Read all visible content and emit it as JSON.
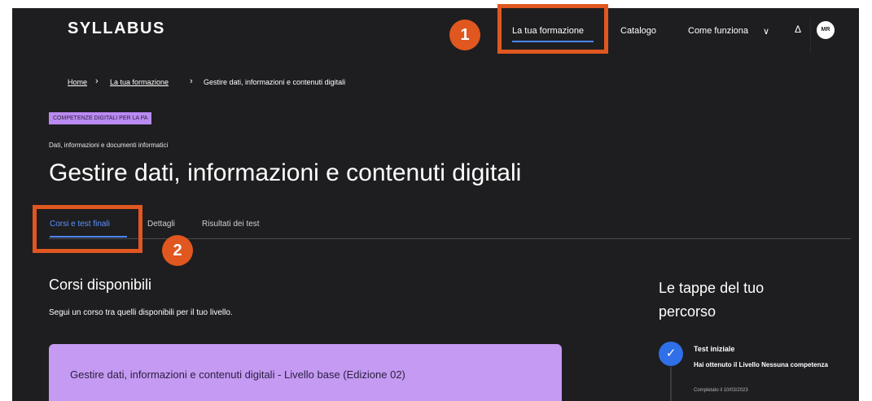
{
  "header": {
    "logo": "SYLLABUS",
    "nav": {
      "formazione": "La tua formazione",
      "catalogo": "Catalogo",
      "come_funziona": "Come funziona",
      "chevron": "∨"
    },
    "bell_glyph": "Δ",
    "avatar_initials": "MR"
  },
  "breadcrumb": {
    "home": "Home",
    "sep": "›",
    "formazione": "La tua formazione",
    "current": "Gestire dati, informazioni e contenuti digitali"
  },
  "page": {
    "tag": "COMPETENZE DIGITALI PER LA PA",
    "subtitle": "Dati, informazioni e documenti informatici",
    "title": "Gestire dati, informazioni e contenuti digitali"
  },
  "tabs": [
    {
      "label": "Corsi e test finali",
      "active": true
    },
    {
      "label": "Dettagli",
      "active": false
    },
    {
      "label": "Risultati dei test",
      "active": false
    }
  ],
  "courses": {
    "title": "Corsi disponibili",
    "description": "Segui un corso tra quelli disponibili per il tuo livello.",
    "items": [
      {
        "title": "Gestire dati, informazioni e contenuti digitali - Livello base (Edizione 02)"
      }
    ]
  },
  "journey": {
    "title": "Le tappe del tuo percorso",
    "steps": [
      {
        "title": "Test iniziale",
        "description": "Hai ottenuto il Livello Nessuna competenza",
        "date": "Completato il 10/03/2023",
        "icon": "check-icon",
        "glyph": "✓"
      }
    ]
  },
  "annotations": {
    "badge1": "1",
    "badge2": "2",
    "color": "#e0571f"
  },
  "colors": {
    "background": "#1e1e20",
    "accent": "#4d86ff",
    "tag": "#b98af0",
    "card": "#c49af2"
  }
}
